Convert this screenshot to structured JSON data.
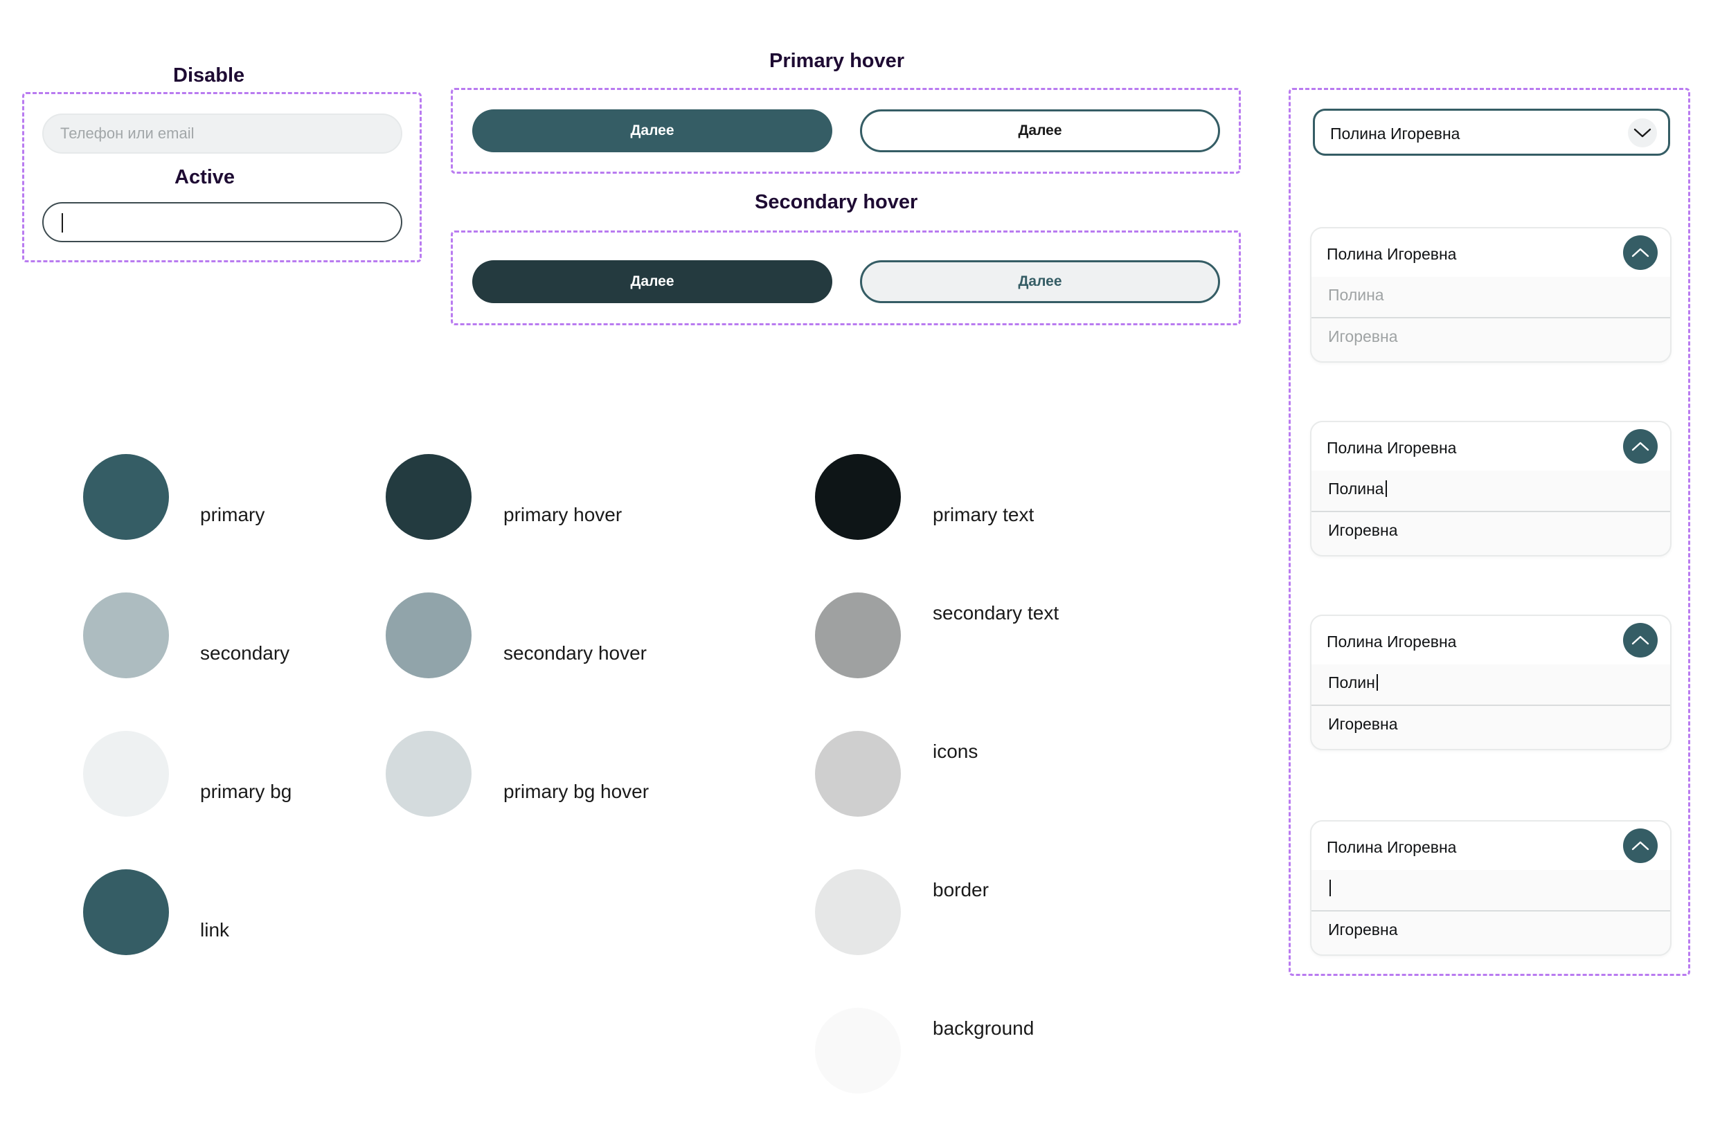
{
  "inputs_section": {
    "disable_title": "Disable",
    "active_title": "Active",
    "disabled_placeholder": "Телефон или email"
  },
  "buttons_section": {
    "primary_hover_title": "Primary hover",
    "secondary_hover_title": "Secondary hover",
    "button_label": "Далее"
  },
  "dropdowns": {
    "closed_value": "Полина Игоревна",
    "states": [
      {
        "header": "Полина Игоревна",
        "row1": "Полина",
        "row2": "Игоревна",
        "row1_style": "placeholder",
        "row2_style": "placeholder"
      },
      {
        "header": "Полина Игоревна",
        "row1": "Полина",
        "row2": "Игоревна",
        "row1_style": "typing",
        "row2_style": "value"
      },
      {
        "header": "Полина Игоревна",
        "row1": "Полин",
        "row2": "Игоревна",
        "row1_style": "typing",
        "row2_style": "value"
      },
      {
        "header": "Полина Игоревна",
        "row1": "",
        "row2": "Игоревна",
        "row1_style": "typing",
        "row2_style": "value"
      }
    ]
  },
  "palette": [
    {
      "name": "primary",
      "color": "#355d65"
    },
    {
      "name": "primary hover",
      "color": "#233b40"
    },
    {
      "name": "primary text",
      "color": "#0e1517"
    },
    {
      "name": "secondary",
      "color": "#adbcc0"
    },
    {
      "name": "secondary hover",
      "color": "#91a4aa"
    },
    {
      "name": "secondary text",
      "color": "#9fa1a1"
    },
    {
      "name": "primary bg",
      "color": "#eef1f2"
    },
    {
      "name": "primary bg hover",
      "color": "#d4dbdd"
    },
    {
      "name": "icons",
      "color": "#cfcfcf"
    },
    {
      "name": "link",
      "color": "#355d65"
    },
    {
      "name": "border",
      "color": "#e6e7e7"
    },
    {
      "name": "background",
      "color": "#f9f9f9"
    }
  ],
  "colors": {
    "accent_dashed": "#b97bf0",
    "title_text": "#1e0b33"
  }
}
